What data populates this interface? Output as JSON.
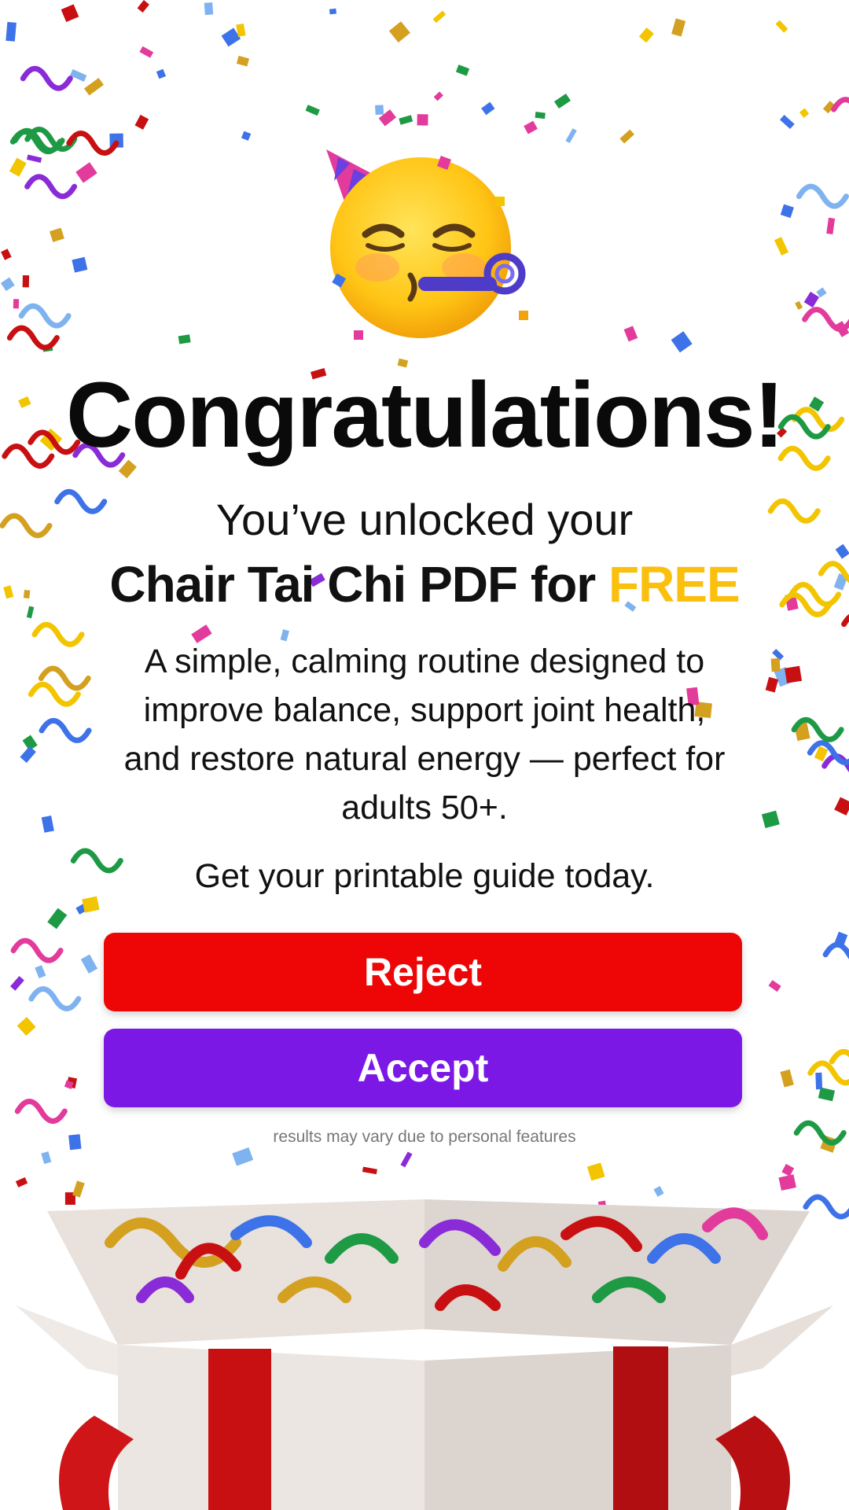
{
  "heading": {
    "title": "Congratulations!",
    "subtitle_line1": "You’ve unlocked your",
    "subtitle_line2_main": "Chair Tai Chi PDF for ",
    "subtitle_line2_highlight": "FREE"
  },
  "description": "A simple, calming routine designed to improve balance, support joint health, and restore natural energy — perfect for adults 50+.",
  "cta_text": "Get your printable guide today.",
  "buttons": {
    "reject_label": "Reject",
    "accept_label": "Accept"
  },
  "disclaimer": "results may vary due to personal features",
  "colors": {
    "highlight": "#FBBF0E",
    "reject": "#EE0606",
    "accept": "#7C18E6",
    "gift_ribbon": "#C81012",
    "gift_box": "#ECE6E2"
  },
  "icons": {
    "party_face": "partying-face-icon",
    "gift_box": "open-gift-box-icon"
  }
}
